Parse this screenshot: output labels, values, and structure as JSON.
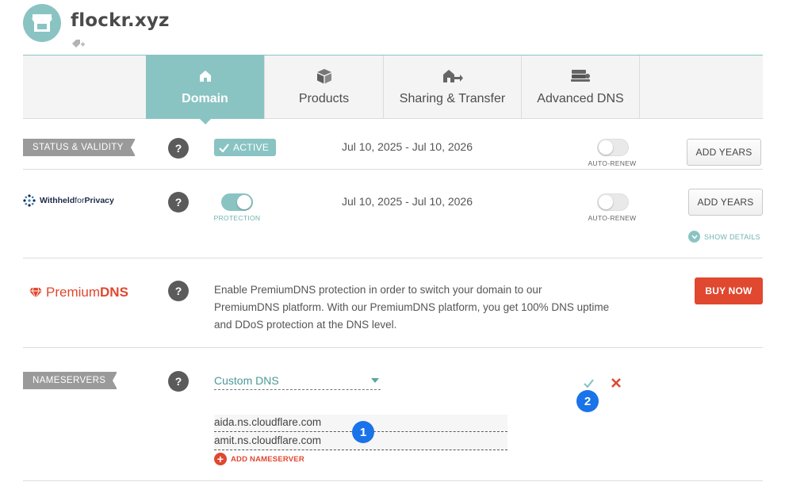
{
  "site": {
    "title": "flockr.xyz"
  },
  "tabs": [
    {
      "label": "Domain",
      "icon": "home-icon",
      "active": true
    },
    {
      "label": "Products",
      "icon": "box-icon",
      "active": false
    },
    {
      "label": "Sharing & Transfer",
      "icon": "house-transfer-icon",
      "active": false
    },
    {
      "label": "Advanced DNS",
      "icon": "server-icon",
      "active": false
    }
  ],
  "status": {
    "label": "STATUS & VALIDITY",
    "help": "?",
    "badge": "ACTIVE",
    "dates": "Jul 10, 2025 - Jul 10, 2026",
    "auto_renew_caption": "AUTO-RENEW",
    "auto_renew_on": false,
    "button": "ADD YEARS"
  },
  "privacy": {
    "logo_bold": "Withheld",
    "logo_light": "for",
    "logo_bold2": "Privacy",
    "help": "?",
    "protection_caption": "PROTECTION",
    "protection_on": true,
    "dates": "Jul 10, 2025 - Jul 10, 2026",
    "auto_renew_caption": "AUTO-RENEW",
    "auto_renew_on": false,
    "button": "ADD YEARS",
    "show_details": "SHOW DETAILS"
  },
  "premium_dns": {
    "logo_light": "Premium",
    "logo_bold": "DNS",
    "help": "?",
    "line1": "Enable PremiumDNS protection in order to switch your domain to our",
    "line2": "PremiumDNS platform. With our PremiumDNS platform, you get 100% DNS uptime",
    "line3": "and DDoS protection at the DNS level.",
    "button": "BUY NOW"
  },
  "nameservers": {
    "label": "NAMESERVERS",
    "help": "?",
    "selected": "Custom DNS",
    "servers": [
      "aida.ns.cloudflare.com",
      "amit.ns.cloudflare.com"
    ],
    "add_label": "ADD NAMESERVER"
  },
  "markers": [
    "1",
    "2"
  ],
  "colors": {
    "teal": "#89c4c3",
    "red": "#e0482f",
    "marker_blue": "#1a73e8"
  }
}
